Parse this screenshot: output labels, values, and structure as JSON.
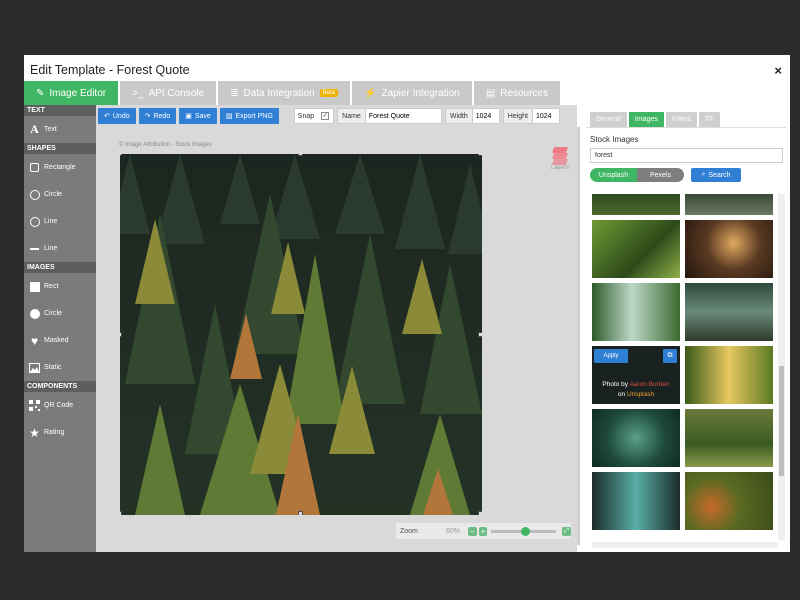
{
  "modal": {
    "title": "Edit Template - Forest Quote",
    "close": "×"
  },
  "tabs": [
    {
      "icon": "✎",
      "label": "Image Editor"
    },
    {
      "icon": ">_",
      "label": "API Console"
    },
    {
      "icon": "≣",
      "label": "Data Integration",
      "badge": "Beta"
    },
    {
      "icon": "⚡",
      "label": "Zapier Integration"
    },
    {
      "icon": "▤",
      "label": "Resources"
    }
  ],
  "sidebar": {
    "text_header": "TEXT",
    "text": "Text",
    "shapes_header": "SHAPES",
    "rectangle": "Rectangle",
    "circle": "Circle",
    "line1": "Line",
    "line2": "Line",
    "images_header": "IMAGES",
    "rect": "Rect",
    "img_circle": "Circle",
    "masked": "Masked",
    "static": "Static",
    "components_header": "COMPONENTS",
    "qr": "QR Code",
    "rating": "Rating"
  },
  "toolbar": {
    "undo": "Undo",
    "redo": "Redo",
    "save": "Save",
    "export": "Export PNG",
    "snap": "Snap",
    "snap_check": "✓",
    "name_label": "Name",
    "name_value": "Forest Quote",
    "width_label": "Width",
    "width_value": "1024",
    "height_label": "Height",
    "height_value": "1024"
  },
  "canvas": {
    "attribution": "© Image Attribution - Stock Images",
    "layers": "Layers",
    "zoom_label": "Zoom",
    "zoom_value": "60%",
    "zoom_level": 0.45
  },
  "right": {
    "tabs": [
      "General",
      "Images",
      "Filters",
      "TF"
    ],
    "stock_title": "Stock Images",
    "search_value": "forest",
    "sources": [
      "Unsplash",
      "Pexels"
    ],
    "search_button": "Search",
    "apply": "Apply",
    "photo_by": "Photo by",
    "author": "Aaron Burden",
    "on": "on",
    "site": "Unsplash"
  },
  "colors": {
    "accent_green": "#3fb663",
    "accent_blue": "#2f7fd5"
  }
}
